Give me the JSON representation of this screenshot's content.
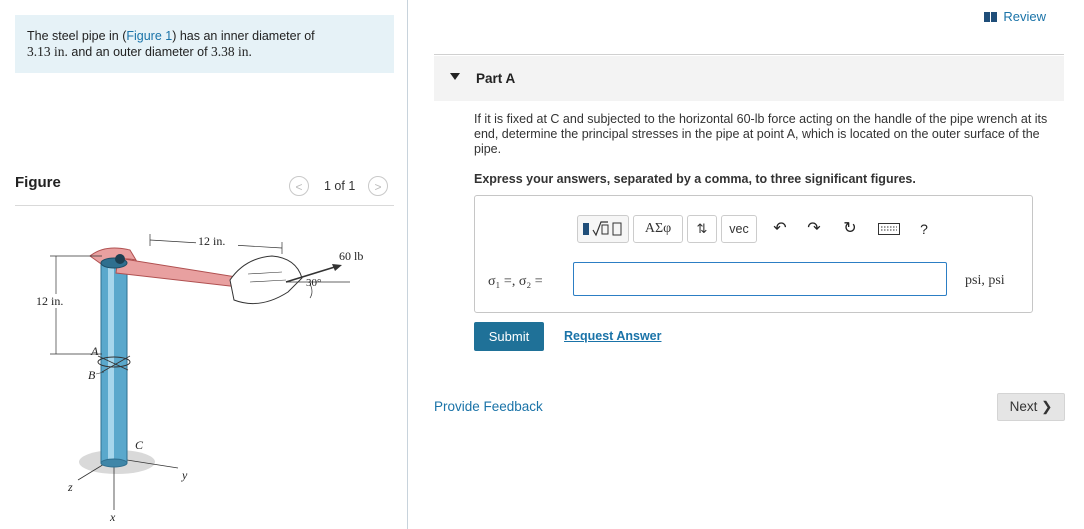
{
  "problem": {
    "text_before_link": "The steel pipe in (",
    "link": "Figure 1",
    "text_after_link": ") has an inner diameter of",
    "inner_diameter": "3.13 in.",
    "text_mid": " and an outer diameter of ",
    "outer_diameter": "3.38 in."
  },
  "figure": {
    "title": "Figure",
    "count": "1 of 1",
    "prev_icon": "chevron-left-icon",
    "next_icon": "chevron-right-icon",
    "labels": {
      "dim_top": "12 in.",
      "force": "60 lb",
      "angle": "30°",
      "dim_left": "12 in.",
      "point_a": "A",
      "point_b": "B",
      "point_c": "C",
      "axis_x": "x",
      "axis_y": "y",
      "axis_z": "z"
    }
  },
  "header": {
    "review": "Review",
    "review_icon": "book-icon"
  },
  "part": {
    "label": "Part A",
    "toggle_icon": "triangle-down-icon"
  },
  "question": "If it is fixed at C and subjected to the horizontal 60-lb force acting on the handle of the pipe wrench at its end, determine the principal stresses in the pipe at point A, which is located on the outer surface of the pipe.",
  "instruction": "Express your answers, separated by a comma, to three significant figures.",
  "toolbar": {
    "greek": "ΑΣφ",
    "vec": "vec",
    "help": "?",
    "icons": [
      "templates-icon",
      "greek-icon",
      "arrows-icon",
      "vec-icon",
      "undo-icon",
      "redo-icon",
      "reset-icon",
      "keyboard-icon",
      "help-icon"
    ]
  },
  "answer": {
    "label": "σ₁ =, σ₂ =",
    "value": "",
    "units": "psi, psi"
  },
  "actions": {
    "submit": "Submit",
    "request": "Request Answer",
    "feedback": "Provide Feedback",
    "next": "Next"
  },
  "colors": {
    "accent": "#1a73a8",
    "submit_bg": "#1f7198",
    "problem_bg": "#e6f2f7",
    "input_border": "#2c7ec4",
    "pipe": "#5aa8cc",
    "wrench": "#e8a0a0"
  }
}
